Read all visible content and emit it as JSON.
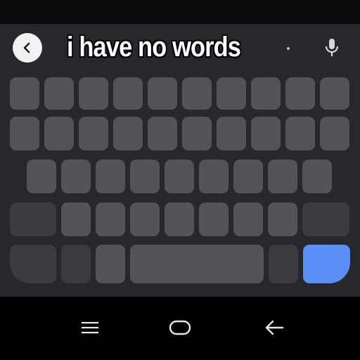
{
  "caption": {
    "text": "i have no words"
  },
  "icons": {
    "back": "chevron-left-icon",
    "mic": "microphone-icon",
    "nav_recents": "recents-icon",
    "nav_home": "home-icon",
    "nav_back": "back-arrow-icon"
  },
  "colors": {
    "keyboard_bg": "#26282b",
    "key": "#535458",
    "key_dark": "#3a3b3e",
    "enter_key": "#5c8ff5"
  }
}
